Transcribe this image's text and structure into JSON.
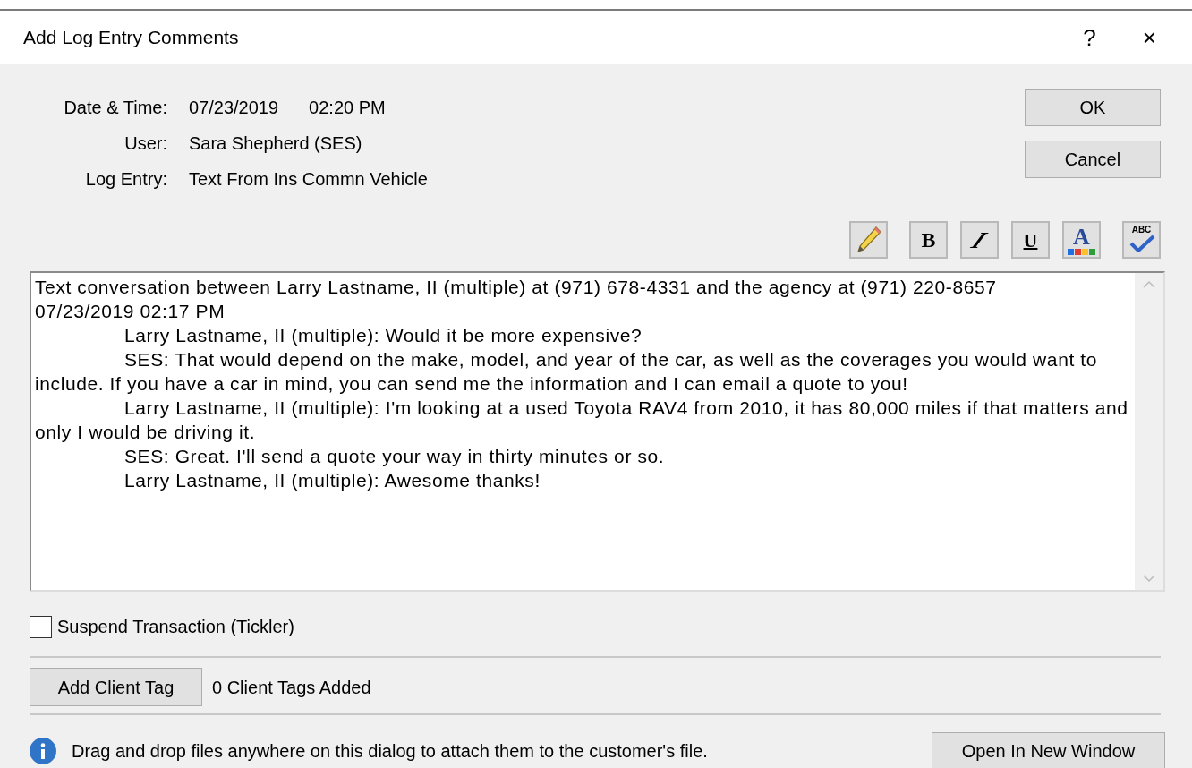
{
  "window": {
    "title": "Add Log Entry Comments",
    "help": "?",
    "close": "×"
  },
  "fields": [
    {
      "label": "Date & Time:",
      "value": "07/23/2019",
      "value_2": "02:20 PM"
    },
    {
      "label": "User:",
      "value": "Sara Shepherd (SES)"
    },
    {
      "label": "Log Entry:",
      "value": "Text From Ins Commn Vehicle"
    }
  ],
  "buttons": [
    "OK",
    "Cancel"
  ],
  "toolbar": [
    {
      "kind": "pencil"
    },
    {
      "kind": "bold",
      "label": "B"
    },
    {
      "kind": "italic",
      "label": "I"
    },
    {
      "kind": "underline",
      "label": "U"
    },
    {
      "kind": "color",
      "label": "A"
    },
    {
      "kind": "spell",
      "label": "ABC"
    }
  ],
  "comments": [
    {
      "text": "Text conversation between Larry Lastname, II (multiple) at (971) 678-4331 and the agency at (971) 220-8657",
      "indented": false
    },
    {
      "text": "07/23/2019 02:17 PM",
      "indented": false
    },
    {
      "text": "Larry Lastname, II (multiple): Would it be more expensive?",
      "indented": true
    },
    {
      "text": "SES: That would depend on the make, model, and year of the car, as well as the coverages you would want to include. If you have a car in mind, you can send me the information and I can email a quote to you!",
      "indented": true
    },
    {
      "text": "Larry Lastname, II (multiple): I'm looking at a used Toyota RAV4 from 2010, it has 80,000 miles if that matters and only I would be driving it.",
      "indented": true
    },
    {
      "text": "SES: Great. I'll send a quote your way in thirty minutes or so.",
      "indented": true
    },
    {
      "text": "Larry Lastname, II (multiple): Awesome thanks!",
      "indented": true
    }
  ],
  "suspend": {
    "label": "Suspend Transaction (Tickler)",
    "checked": false
  },
  "client_tags": {
    "button": "Add Client Tag",
    "status": "0 Client Tags Added"
  },
  "footer": {
    "info": "Drag and drop files anywhere on this dialog to attach them to the customer's file.",
    "button": "Open In New Window"
  }
}
